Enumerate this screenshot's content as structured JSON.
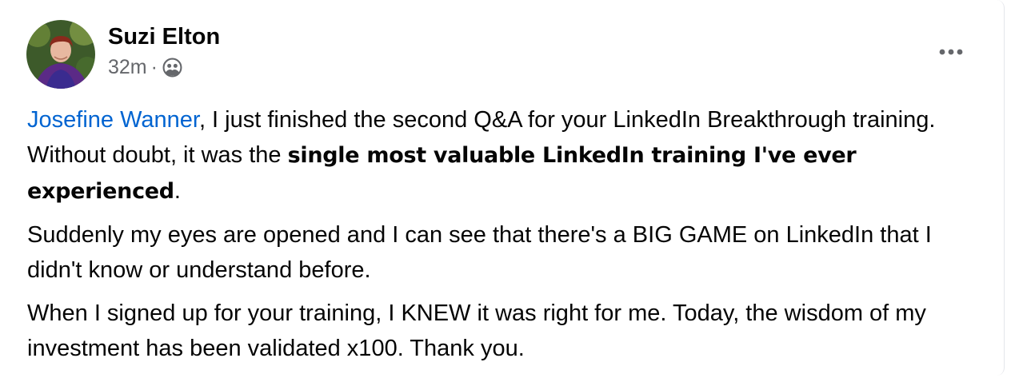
{
  "post": {
    "author": {
      "name": "Suzi Elton",
      "avatar_icon": "profile-photo",
      "avatar_colors": {
        "background": "#3d5a2a",
        "clothing": "#5b2a86",
        "hair": "#8a2a1c"
      }
    },
    "meta": {
      "time": "32m",
      "separator": "·",
      "audience_icon": "friends-icon"
    },
    "more_icon": "more-dots-icon",
    "paragraphs": {
      "p1": {
        "mention": "Josefine Wanner",
        "text_a": ", I just finished the second Q&A for your LinkedIn Breakthrough training. Without doubt, it was the ",
        "bold": "single most valuable LinkedIn training I've ever experienced",
        "text_b": "."
      },
      "p2": "Suddenly my eyes are opened and I can see that there's a BIG GAME on LinkedIn that I didn't know or understand before.",
      "p3": "When I signed up for your training, I KNEW it was right for me. Today, the wisdom of my investment has been validated x100. Thank you."
    },
    "colors": {
      "mention": "#0064d1",
      "meta_text": "#65676b",
      "text": "#050505"
    }
  }
}
